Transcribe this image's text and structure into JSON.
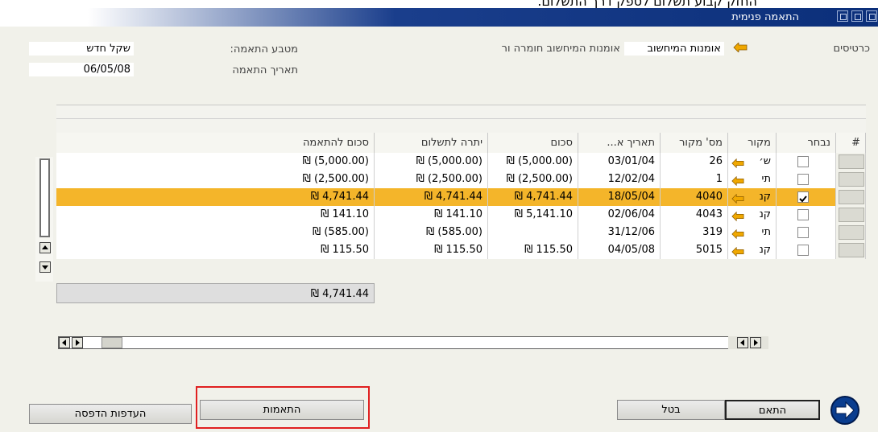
{
  "top_caption": "החזק קבוע תשלום לספק דרך התשלום.",
  "window": {
    "title": "התאמה פנימית"
  },
  "header": {
    "cards_label": "כרטיסים",
    "bp_code": "אומנות המיחשוב",
    "bp_name": "אומנות המיחשוב חומרה ור",
    "currency_label": "מטבע התאמה:",
    "currency_value": "שקל חדש",
    "date_label": "תאריך התאמה",
    "date_value": "06/05/08"
  },
  "table": {
    "columns": [
      "#",
      "נבחר",
      "מקור",
      "מס' מקור",
      "תאריך א...",
      "סכום",
      "יתרה לתשלום",
      "סכום להתאמה"
    ],
    "rows": [
      {
        "selected": false,
        "origin": "ש׳",
        "origin_no": "26",
        "date": "03/01/04",
        "amount": "₪ (5,000.00)",
        "balance": "₪ (5,000.00)",
        "match": "₪ (5,000.00)"
      },
      {
        "selected": false,
        "origin": "תי",
        "origin_no": "1",
        "date": "12/02/04",
        "amount": "₪ (2,500.00)",
        "balance": "₪ (2,500.00)",
        "match": "₪ (2,500.00)"
      },
      {
        "selected": true,
        "origin": "קנ",
        "origin_no": "4040",
        "date": "18/05/04",
        "amount": "₪ 4,741.44",
        "balance": "₪ 4,741.44",
        "match": "₪ 4,741.44"
      },
      {
        "selected": false,
        "origin": "קנ",
        "origin_no": "4043",
        "date": "02/06/04",
        "amount": "₪ 5,141.10",
        "balance": "₪ 141.10",
        "match": "₪ 141.10"
      },
      {
        "selected": false,
        "origin": "תי",
        "origin_no": "319",
        "date": "31/12/06",
        "amount": "",
        "balance": "₪ (585.00)",
        "match": "₪ (585.00)"
      },
      {
        "selected": false,
        "origin": "קנ",
        "origin_no": "5015",
        "date": "04/05/08",
        "amount": "₪ 115.50",
        "balance": "₪ 115.50",
        "match": "₪ 115.50"
      }
    ],
    "total": "₪ 4,741.44"
  },
  "buttons": {
    "print_prefs": "העדפות הדפסה",
    "reconciliations": "התאמות",
    "cancel": "בטל",
    "reconcile": "התאם"
  },
  "colors": {
    "selected_row": "#f4b52a",
    "highlight_box": "#e02020",
    "title_bar": "#1a3e8c",
    "arrow": "#f0a800"
  }
}
